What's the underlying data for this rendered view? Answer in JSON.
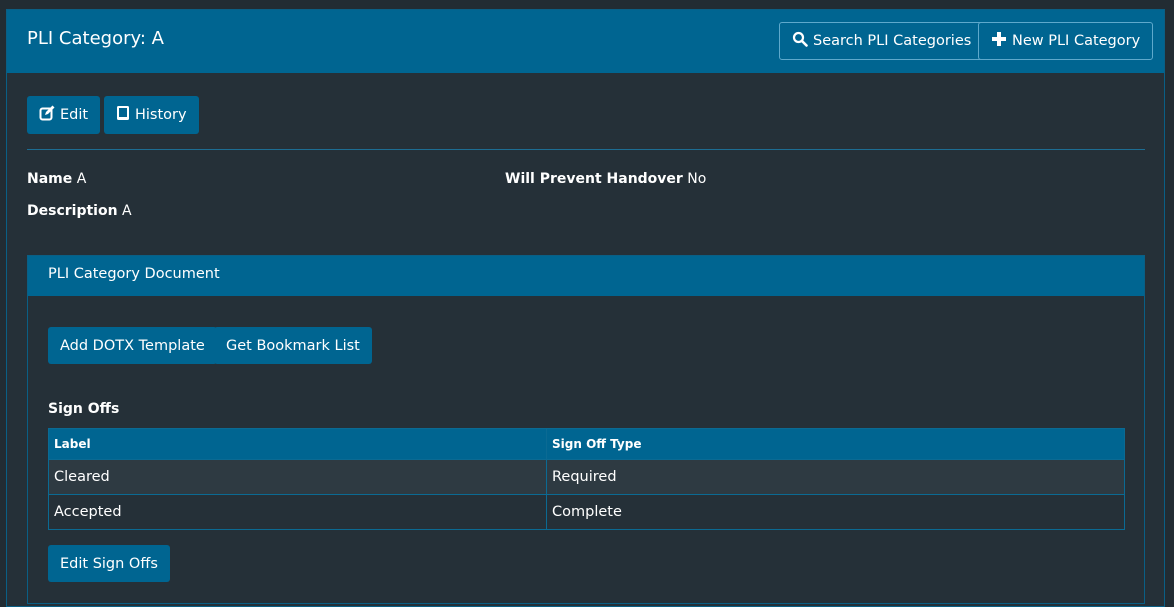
{
  "header": {
    "title": "PLI Category: A",
    "search_button": "Search PLI Categories",
    "new_button": "New PLI Category"
  },
  "toolbar": {
    "edit_label": "Edit",
    "history_label": "History"
  },
  "details": {
    "name_label": "Name",
    "name_value": "A",
    "description_label": "Description",
    "description_value": "A",
    "prevent_label": "Will Prevent Handover",
    "prevent_value": "No"
  },
  "document_panel": {
    "title": "PLI Category Document",
    "add_template_button": "Add DOTX Template",
    "bookmark_button": "Get Bookmark List",
    "signoffs_title": "Sign Offs",
    "table": {
      "columns": [
        "Label",
        "Sign Off Type"
      ],
      "rows": [
        [
          "Cleared",
          "Required"
        ],
        [
          "Accepted",
          "Complete"
        ]
      ]
    },
    "edit_signoffs_button": "Edit Sign Offs"
  },
  "colors": {
    "accent": "#006591",
    "background": "#222c33",
    "panel": "#253038"
  },
  "icons": [
    "search-icon",
    "plus-icon",
    "edit-icon",
    "book-icon"
  ]
}
